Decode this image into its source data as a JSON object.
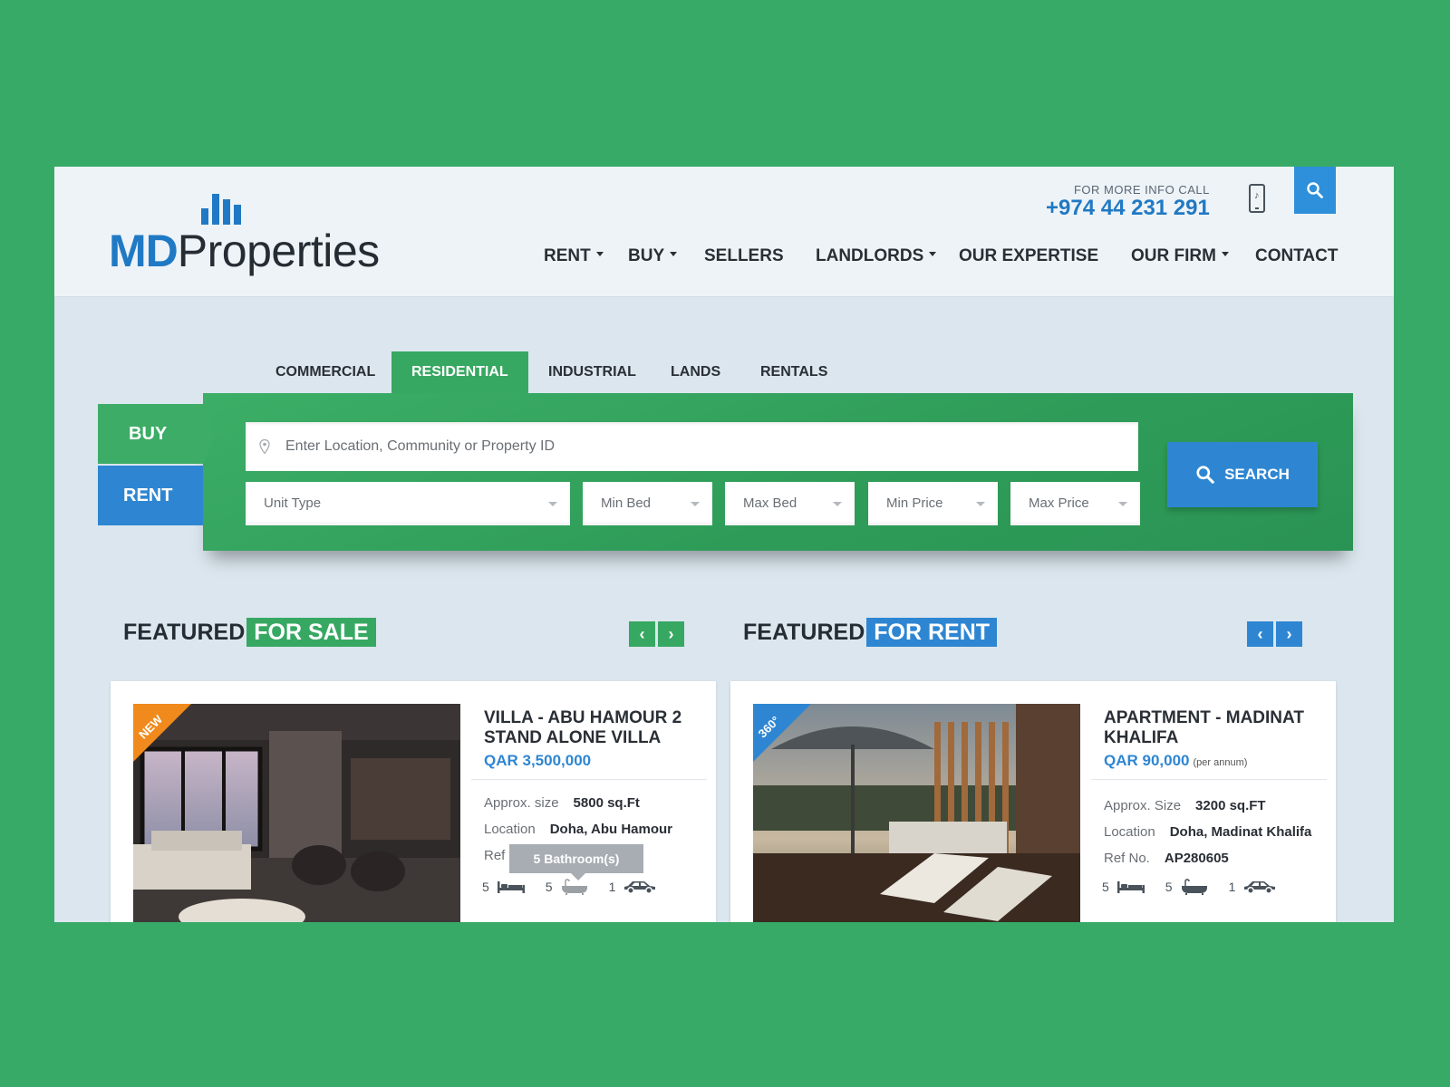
{
  "brand": {
    "md": "MD",
    "properties": "Properties"
  },
  "contact": {
    "label": "FOR MORE INFO CALL",
    "phone": "+974 44 231 291"
  },
  "nav": {
    "rent": "RENT",
    "buy": "BUY",
    "sellers": "SELLERS",
    "landlords": "LANDLORDS",
    "expertise": "OUR EXPERTISE",
    "firm": "OUR FIRM",
    "contact": "CONTACT"
  },
  "categories": {
    "commercial": "COMMERCIAL",
    "residential": "RESIDENTIAL",
    "industrial": "INDUSTRIAL",
    "lands": "LANDS",
    "rentals": "RENTALS",
    "active": "RESIDENTIAL"
  },
  "search": {
    "mode_buy": "BUY",
    "mode_rent": "RENT",
    "placeholder": "Enter Location, Community or Property ID",
    "unit_type": "Unit Type",
    "min_bed": "Min Bed",
    "max_bed": "Max Bed",
    "min_price": "Min Price",
    "max_price": "Max Price",
    "button": "SEARCH"
  },
  "featured_sale": {
    "heading": "FEATURED",
    "highlight": "FOR SALE",
    "ribbon": "NEW",
    "title": "VILLA - ABU HAMOUR 2 STAND ALONE VILLA",
    "price": "QAR 3,500,000",
    "size_label": "Approx. size",
    "size": "5800 sq.Ft",
    "location_label": "Location",
    "location": "Doha, Abu Hamour",
    "ref_label": "Ref N",
    "tooltip": "5 Bathroom(s)",
    "beds": "5",
    "baths": "5",
    "cars": "1"
  },
  "featured_rent": {
    "heading": "FEATURED",
    "highlight": "FOR RENT",
    "ribbon": "360°",
    "title": "APARTMENT - MADINAT KHALIFA",
    "price": "QAR 90,000",
    "price_note": "(per annum)",
    "size_label": "Approx. Size",
    "size": "3200 sq.FT",
    "location_label": "Location",
    "location": "Doha, Madinat Khalifa",
    "ref_label": "Ref No.",
    "ref": "AP280605",
    "beds": "5",
    "baths": "5",
    "cars": "1"
  },
  "colors": {
    "brand_blue": "#2079c4",
    "green": "#37a862",
    "page_bg": "#38aa68"
  }
}
